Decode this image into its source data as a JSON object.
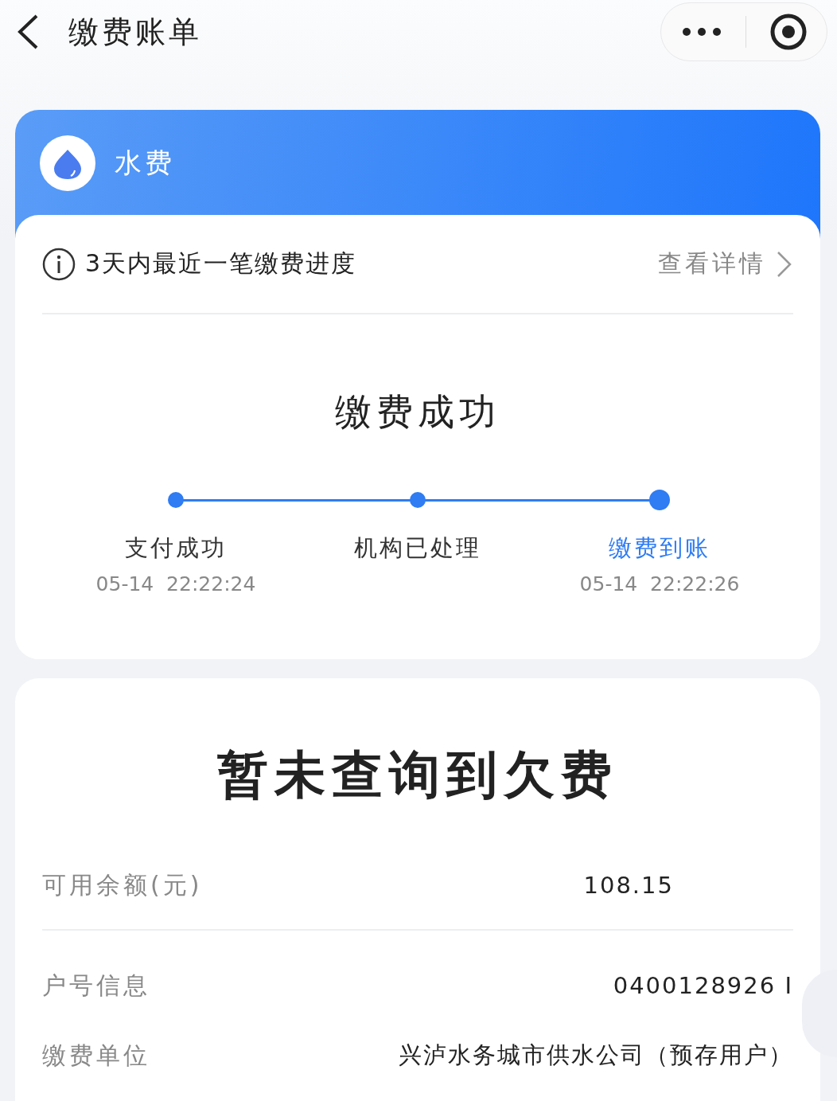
{
  "nav": {
    "title": "缴费账单"
  },
  "bill": {
    "category": "水费",
    "progress_title": "3天内最近一笔缴费进度",
    "details_link": "查看详情",
    "status": "缴费成功",
    "steps": [
      {
        "label": "支付成功",
        "time": "05-14  22:22:24",
        "selected": false
      },
      {
        "label": "机构已处理",
        "selected": false
      },
      {
        "label": "缴费到账",
        "time": "05-14  22:22:26",
        "selected": true
      }
    ]
  },
  "arrears": {
    "headline": "暂未查询到欠费",
    "rows": [
      {
        "label": "可用余额(元)",
        "value": "108.15"
      },
      {
        "label": "户号信息",
        "value": "0400128926 I"
      },
      {
        "label": "缴费单位",
        "value": "兴泸水务城市供水公司（预存用户）"
      }
    ]
  }
}
